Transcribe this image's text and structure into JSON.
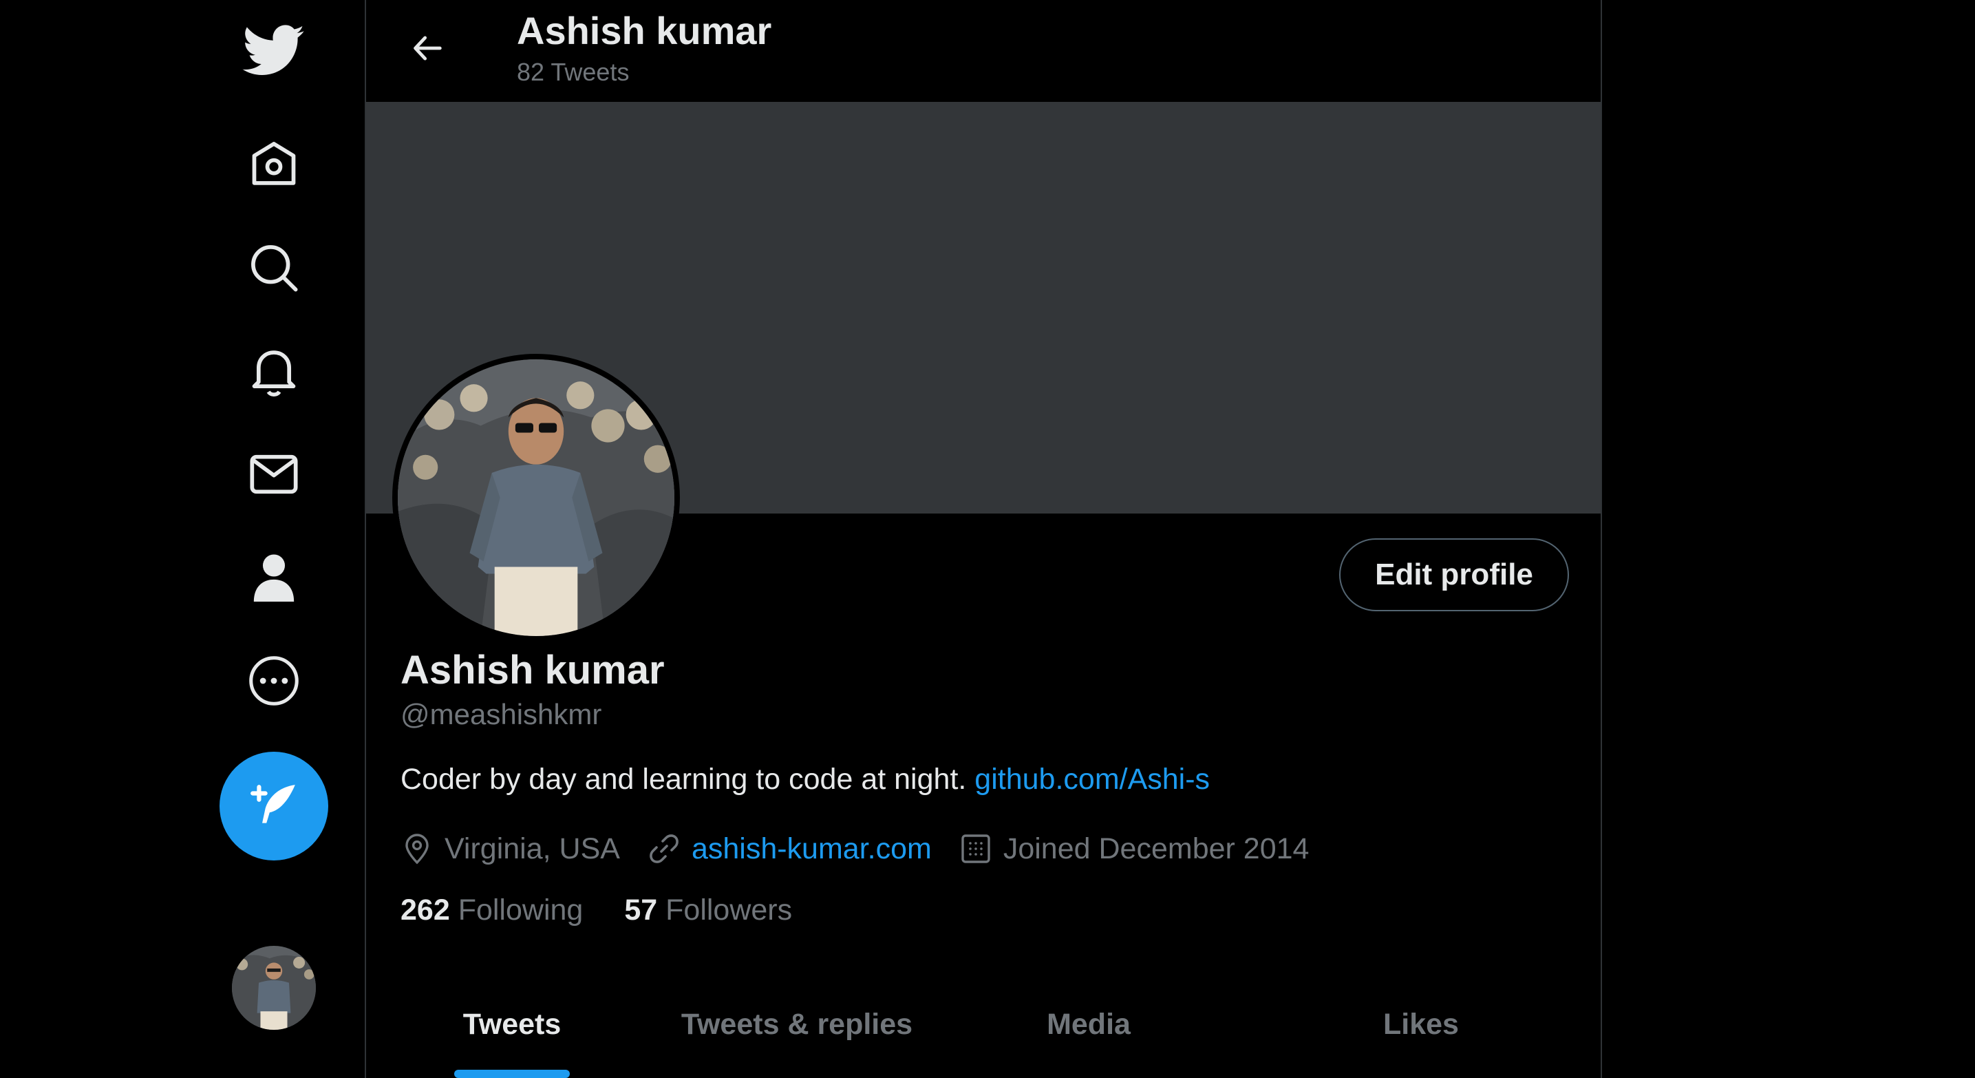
{
  "colors": {
    "accent": "#1d9bf0",
    "background": "#000000",
    "banner": "#333639",
    "text_primary": "#e7e9ea",
    "text_secondary": "#71767b"
  },
  "nav": {
    "items": [
      {
        "icon": "twitter-logo-icon"
      },
      {
        "icon": "home-icon"
      },
      {
        "icon": "search-icon"
      },
      {
        "icon": "bell-icon"
      },
      {
        "icon": "mail-icon"
      },
      {
        "icon": "person-icon"
      },
      {
        "icon": "more-icon"
      }
    ],
    "compose_icon": "compose-feather-icon"
  },
  "header": {
    "name": "Ashish kumar",
    "tweet_count": "82 Tweets"
  },
  "profile": {
    "name": "Ashish kumar",
    "handle": "@meashishkmr",
    "edit_label": "Edit profile",
    "bio_text": "Coder by day and learning to code at night.",
    "bio_link": "github.com/Ashi-s",
    "location": "Virginia, USA",
    "website": "ashish-kumar.com",
    "joined": "Joined December 2014",
    "following_count": "262",
    "following_label": "Following",
    "followers_count": "57",
    "followers_label": "Followers"
  },
  "tabs": [
    {
      "label": "Tweets",
      "active": true
    },
    {
      "label": "Tweets & replies",
      "active": false
    },
    {
      "label": "Media",
      "active": false
    },
    {
      "label": "Likes",
      "active": false
    }
  ]
}
